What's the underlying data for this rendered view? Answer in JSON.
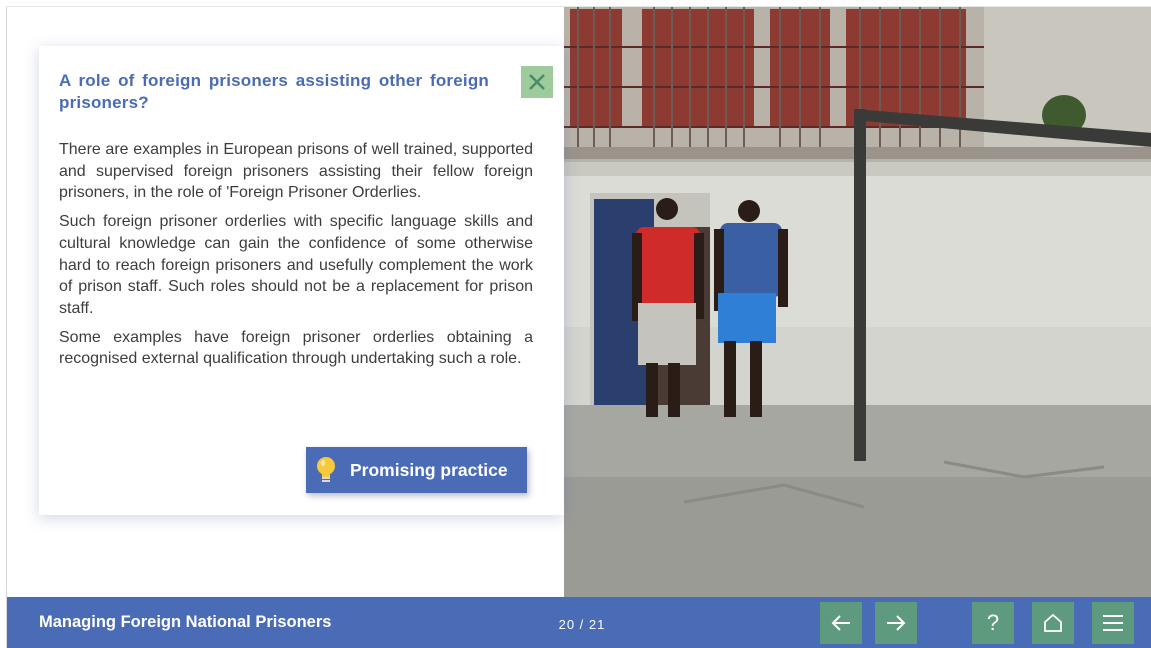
{
  "course": {
    "title": "Managing Foreign National Prisoners",
    "page_current": "20",
    "page_total": "21",
    "page_indicator": "20 / 21"
  },
  "card": {
    "title": "A role of foreign prisoners assisting other foreign prisoners?",
    "paragraphs": [
      "There are examples in European prisons of well trained, supported and supervised foreign prisoners assisting their fellow foreign prisoners, in the role of 'Foreign Prisoner Orderlies.",
      "Such foreign prisoner orderlies with specific language skills and cultural knowledge can gain the confidence of some otherwise hard to reach foreign prisoners and usefully complement the work of prison staff. Such roles should not be a replacement for prison staff.",
      "Some examples have foreign prisoner orderlies obtaining a recognised external qualification through undertaking such a role."
    ],
    "close_icon": "close-icon",
    "promo_button": {
      "label": "Promising practice",
      "icon": "lightbulb-icon"
    }
  },
  "footer_nav": {
    "buttons": [
      {
        "name": "previous-button",
        "icon": "arrow-left-icon"
      },
      {
        "name": "next-button",
        "icon": "arrow-right-icon"
      },
      {
        "name": "help-button",
        "icon": "question-icon",
        "glyph": "?"
      },
      {
        "name": "home-button",
        "icon": "home-icon"
      },
      {
        "name": "menu-button",
        "icon": "hamburger-menu-icon"
      }
    ]
  },
  "colors": {
    "primary": "#4a6bb5",
    "nav_button": "#5e9a7e",
    "close_button": "#9ecb9b",
    "body_text": "#3d3d3d",
    "bulb": "#f7c93e"
  }
}
